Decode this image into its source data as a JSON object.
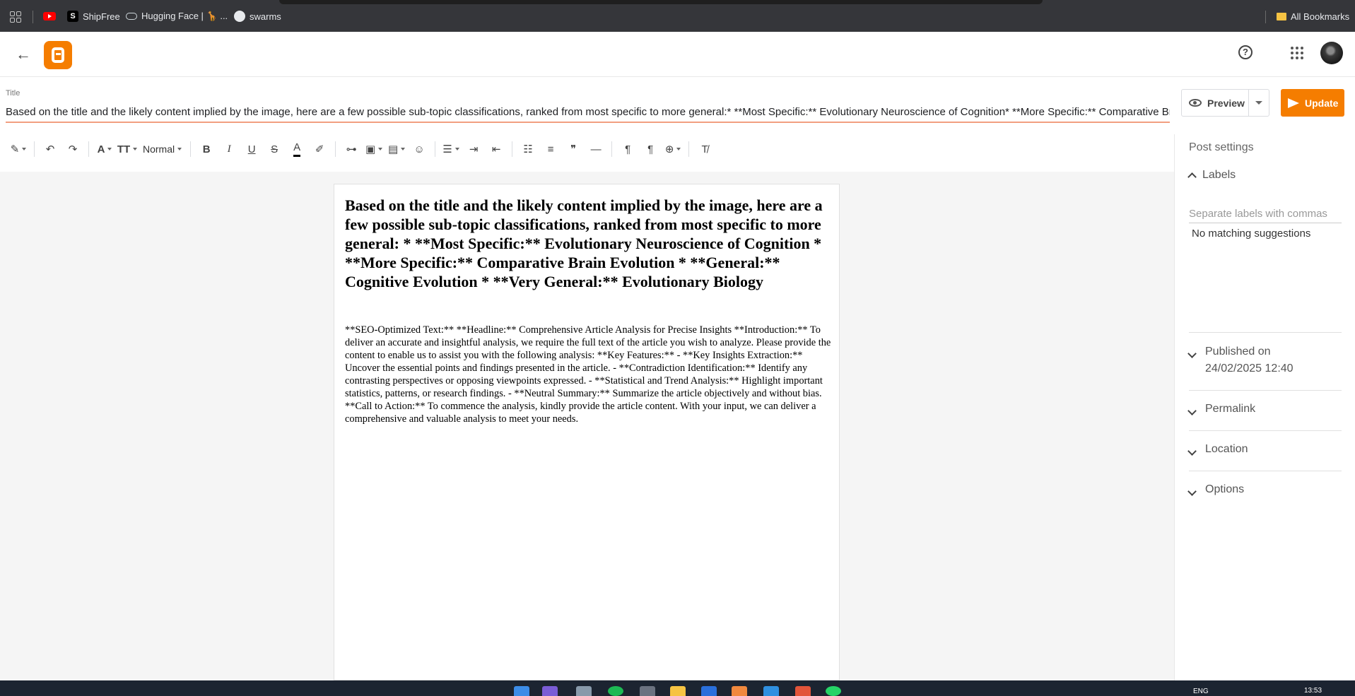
{
  "bookmarks": {
    "items": [
      {
        "label": ""
      },
      {
        "label": "ShipFree"
      },
      {
        "label": "Hugging Face | 🦒 ..."
      },
      {
        "label": "swarms"
      }
    ],
    "all_bookmarks": "All Bookmarks"
  },
  "icons": {
    "back": "←",
    "help": "?",
    "bold": "B",
    "italic": "I",
    "underline": "U",
    "strike": "S",
    "text_color": "A",
    "quote": "❞",
    "hr": "—"
  },
  "editor": {
    "title_label": "Title",
    "title_value": "Based on the title and the likely content implied by the image, here are a few possible sub-topic classifications, ranked from most specific to more general:*   **Most Specific:** Evolutionary Neuroscience of Cognition*   **More Specific:** Comparative Brain Evolution*   **General:** Cognitive Evolution*   **Very General:** Evolutionary Biology",
    "format_select": "Normal",
    "preview_label": "Preview",
    "update_label": "Update",
    "heading": "Based on the title and the likely content implied by the image, here are a few possible sub-topic classifications, ranked from most specific to more general: * **Most Specific:** Evolutionary Neuroscience of Cognition * **More Specific:** Comparative Brain Evolution * **General:** Cognitive Evolution * **Very General:** Evolutionary Biology",
    "body": "**SEO-Optimized Text:** **Headline:** Comprehensive Article Analysis for Precise Insights **Introduction:** To deliver an accurate and insightful analysis, we require the full text of the article you wish to analyze. Please provide the content to enable us to assist you with the following analysis: **Key Features:** - **Key Insights Extraction:** Uncover the essential points and findings presented in the article. - **Contradiction Identification:** Identify any contrasting perspectives or opposing viewpoints expressed. - **Statistical and Trend Analysis:** Highlight important statistics, patterns, or research findings. - **Neutral Summary:** Summarize the article objectively and without bias. **Call to Action:** To commence the analysis, kindly provide the article content. With your input, we can deliver a comprehensive and valuable analysis to meet your needs."
  },
  "sidebar": {
    "title": "Post settings",
    "labels_title": "Labels",
    "labels_placeholder": "Separate labels with commas",
    "no_suggestions": "No matching suggestions",
    "published_label": "Published on",
    "published_date": "24/02/2025 12:40",
    "permalink": "Permalink",
    "location": "Location",
    "options": "Options"
  },
  "taskbar": {
    "lang": "ENG",
    "time": "13:53"
  },
  "colors": {
    "brand": "#f57d00",
    "title_underline": "#f29f80",
    "bookmarks_bar": "#35363a"
  }
}
